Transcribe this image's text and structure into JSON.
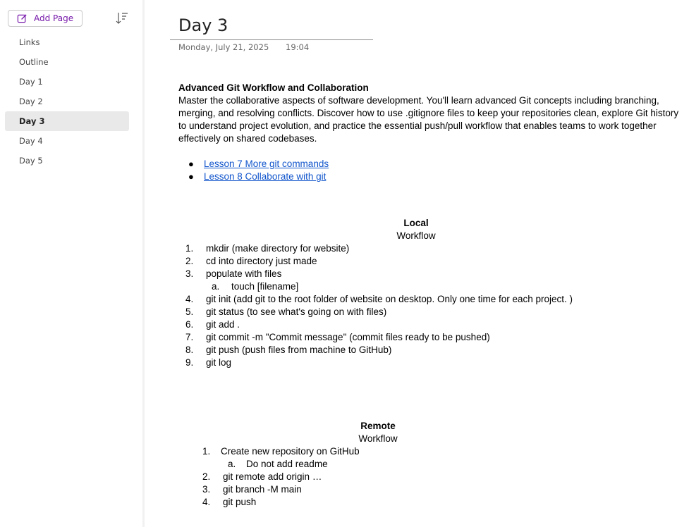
{
  "sidebar": {
    "add_page_label": "Add Page",
    "pages": [
      {
        "label": "Links"
      },
      {
        "label": "Outline"
      },
      {
        "label": "Day 1"
      },
      {
        "label": "Day 2"
      },
      {
        "label": "Day 3"
      },
      {
        "label": "Day 4"
      },
      {
        "label": "Day 5"
      }
    ]
  },
  "note": {
    "title": "Day 3",
    "date": "Monday, July 21, 2025",
    "time": "19:04",
    "heading": "Advanced Git Workflow and Collaboration",
    "intro": "Master the collaborative aspects of software development. You'll learn advanced Git concepts including branching, merging, and resolving conflicts. Discover how to use .gitignore files to keep your repositories clean, explore Git history to understand project evolution, and practice the essential push/pull workflow that enables teams to work together effectively on shared codebases.",
    "links": [
      {
        "label": "Lesson 7 More git commands"
      },
      {
        "label": "Lesson 8 Collaborate with git"
      }
    ],
    "local": {
      "title": "Local",
      "subtitle": "Workflow",
      "steps": [
        {
          "num": "1.",
          "text": "mkdir (make directory for website)"
        },
        {
          "num": "2.",
          "text": "cd into directory just made"
        },
        {
          "num": "3.",
          "text": "populate with files"
        },
        {
          "num": "a.",
          "text": "touch [filename]",
          "sub": true
        },
        {
          "num": "4.",
          "text": "git init (add git to the root folder of website on desktop. Only one time for each project. )"
        },
        {
          "num": "5.",
          "text": "git status (to see what's going on with files)"
        },
        {
          "num": "6.",
          "text": "git add ."
        },
        {
          "num": "7.",
          "text": "git commit -m \"Commit message\" (commit files ready to be pushed)"
        },
        {
          "num": "8.",
          "text": "git push (push files from machine to GitHub)"
        },
        {
          "num": "9.",
          "text": "git log"
        }
      ]
    },
    "remote": {
      "title": "Remote",
      "subtitle": "Workflow",
      "steps": [
        {
          "num": "1.",
          "text": "Create new repository on GitHub"
        },
        {
          "num": "a.",
          "text": "Do not add readme",
          "sub": true
        },
        {
          "num": "2.",
          "text": "git remote add origin …"
        },
        {
          "num": "3.",
          "text": "git branch -M main"
        },
        {
          "num": "4.",
          "text": "git push"
        }
      ]
    }
  }
}
